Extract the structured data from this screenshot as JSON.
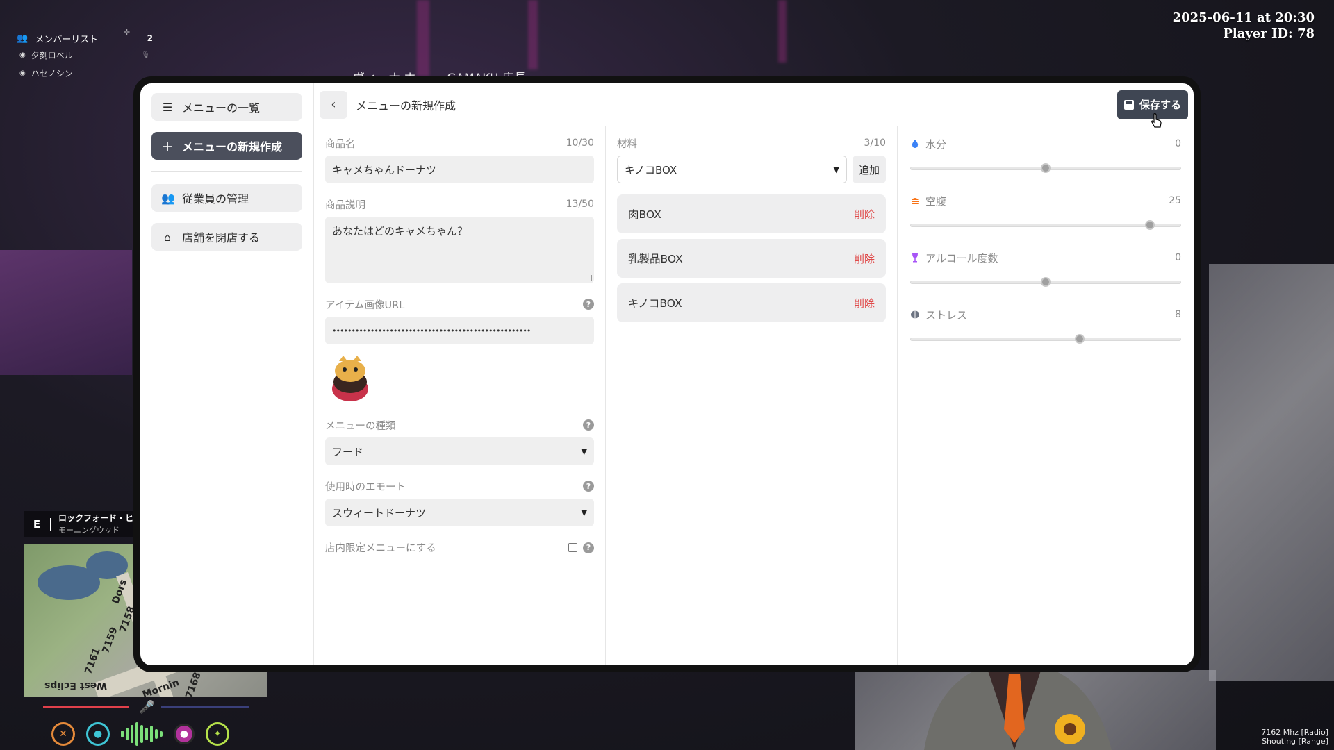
{
  "hud": {
    "member_list_title": "メンバーリスト",
    "member_count": "2",
    "members": [
      "夕刻ロベル",
      "ハセノシン"
    ],
    "datetime": "2025-06-11 at 20:30",
    "player_id": "Player ID: 78",
    "behind_text": "ヴィーナ ホー ー GAMAKU 店長",
    "compass": "E",
    "street": "ロックフォード・ヒ",
    "street_sub": "モーニングウッド",
    "freq_line1": "7162 Mhz [Radio]",
    "freq_line2": "Shouting [Range]",
    "map_labels": [
      "Dors",
      "7158",
      "7159",
      "7161",
      "West Eclips",
      "7168",
      "Mornin"
    ],
    "health_percent": 100,
    "armor_percent": 0
  },
  "sidebar": {
    "items": [
      {
        "label": "メニューの一覧",
        "icon": "list-icon"
      },
      {
        "label": "メニューの新規作成",
        "icon": "plus-icon"
      },
      {
        "label": "従業員の管理",
        "icon": "users-icon"
      },
      {
        "label": "店舗を閉店する",
        "icon": "store-icon"
      }
    ]
  },
  "topbar": {
    "title": "メニューの新規作成",
    "save_label": "保存する"
  },
  "form": {
    "name_label": "商品名",
    "name_count": "10/30",
    "name_value": "キャメちゃんドーナツ",
    "desc_label": "商品説明",
    "desc_count": "13/50",
    "desc_value": "あなたはどのキャメちゃん？",
    "image_label": "アイテム画像URL",
    "image_value": "••••••••••••••••••••••••••••••••••••••••••••••••••••",
    "type_label": "メニューの種類",
    "type_value": "フード",
    "emote_label": "使用時のエモート",
    "emote_value": "スウィートドーナツ",
    "limited_label": "店内限定メニューにする",
    "help": "?"
  },
  "materials": {
    "label": "材料",
    "count": "3/10",
    "select_value": "キノコBOX",
    "add_label": "追加",
    "delete_label": "削除",
    "items": [
      "肉BOX",
      "乳製品BOX",
      "キノコBOX"
    ]
  },
  "stats": [
    {
      "label": "水分",
      "value": "0",
      "icon": "water-drop-icon",
      "color": "#3b82f6",
      "fraction": 0.5
    },
    {
      "label": "空腹",
      "value": "25",
      "icon": "burger-icon",
      "color": "#f97316",
      "fraction": 0.885
    },
    {
      "label": "アルコール度数",
      "value": "0",
      "icon": "wine-glass-icon",
      "color": "#a855f7",
      "fraction": 0.5
    },
    {
      "label": "ストレス",
      "value": "8",
      "icon": "brain-icon",
      "color": "#6b7280",
      "fraction": 0.625
    }
  ]
}
